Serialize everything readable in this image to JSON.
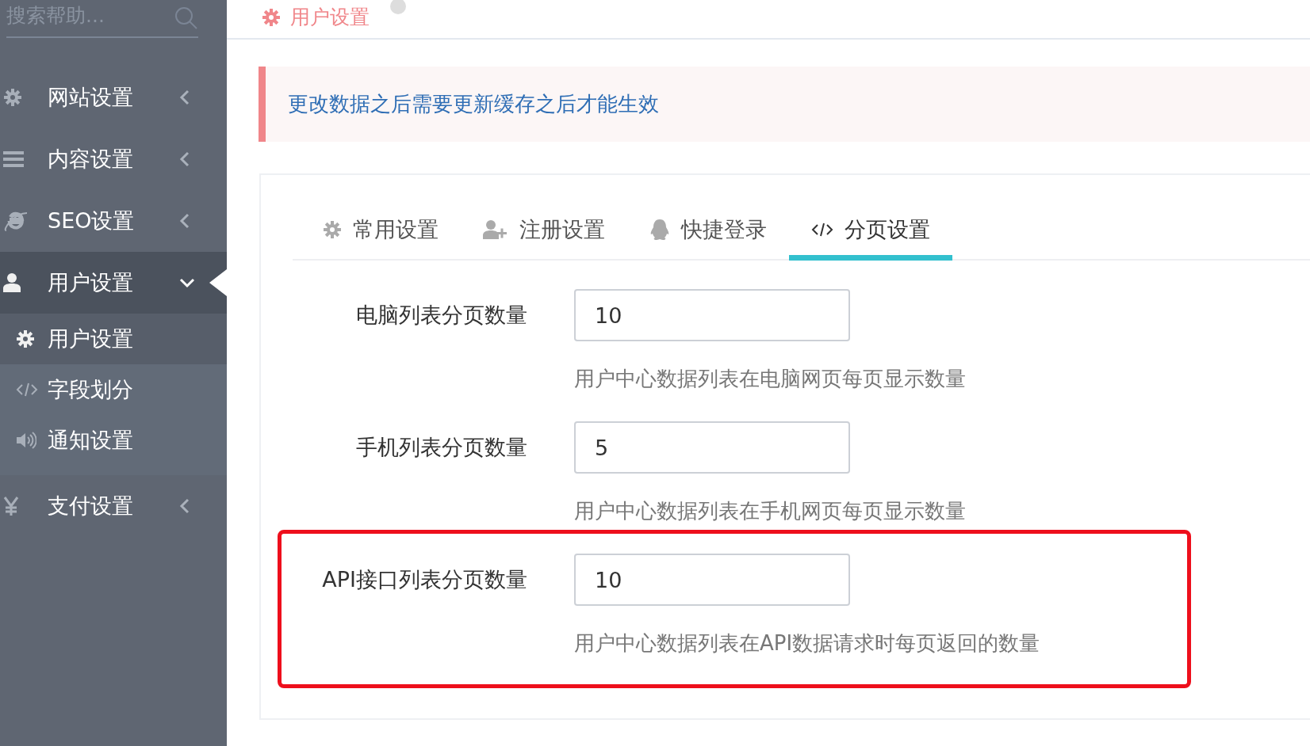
{
  "sidebar": {
    "search": {
      "placeholder": "搜索帮助..."
    },
    "items": [
      {
        "label": "网站设置",
        "expanded": false,
        "selected": false
      },
      {
        "label": "内容设置",
        "expanded": false,
        "selected": false
      },
      {
        "label": "SEO设置",
        "expanded": false,
        "selected": false
      },
      {
        "label": "用户设置",
        "expanded": true,
        "selected": true,
        "children": [
          {
            "label": "用户设置",
            "selected": true
          },
          {
            "label": "字段划分",
            "selected": false
          },
          {
            "label": "通知设置",
            "selected": false
          }
        ]
      },
      {
        "label": "支付设置",
        "expanded": false,
        "selected": false
      }
    ]
  },
  "breadcrumb": {
    "title": "用户设置"
  },
  "alert": {
    "text": "更改数据之后需要更新缓存之后才能生效"
  },
  "tabs": [
    {
      "label": "常用设置",
      "selected": false
    },
    {
      "label": "注册设置",
      "selected": false
    },
    {
      "label": "快捷登录",
      "selected": false
    },
    {
      "label": "分页设置",
      "selected": true
    }
  ],
  "fields": [
    {
      "label": "电脑列表分页数量",
      "value": "10",
      "help": "用户中心数据列表在电脑网页每页显示数量",
      "highlighted": false
    },
    {
      "label": "手机列表分页数量",
      "value": "5",
      "help": "用户中心数据列表在手机网页每页显示数量",
      "highlighted": false
    },
    {
      "label": "API接口列表分页数量",
      "value": "10",
      "help": "用户中心数据列表在API数据请求时每页返回的数量",
      "highlighted": true
    }
  ]
}
